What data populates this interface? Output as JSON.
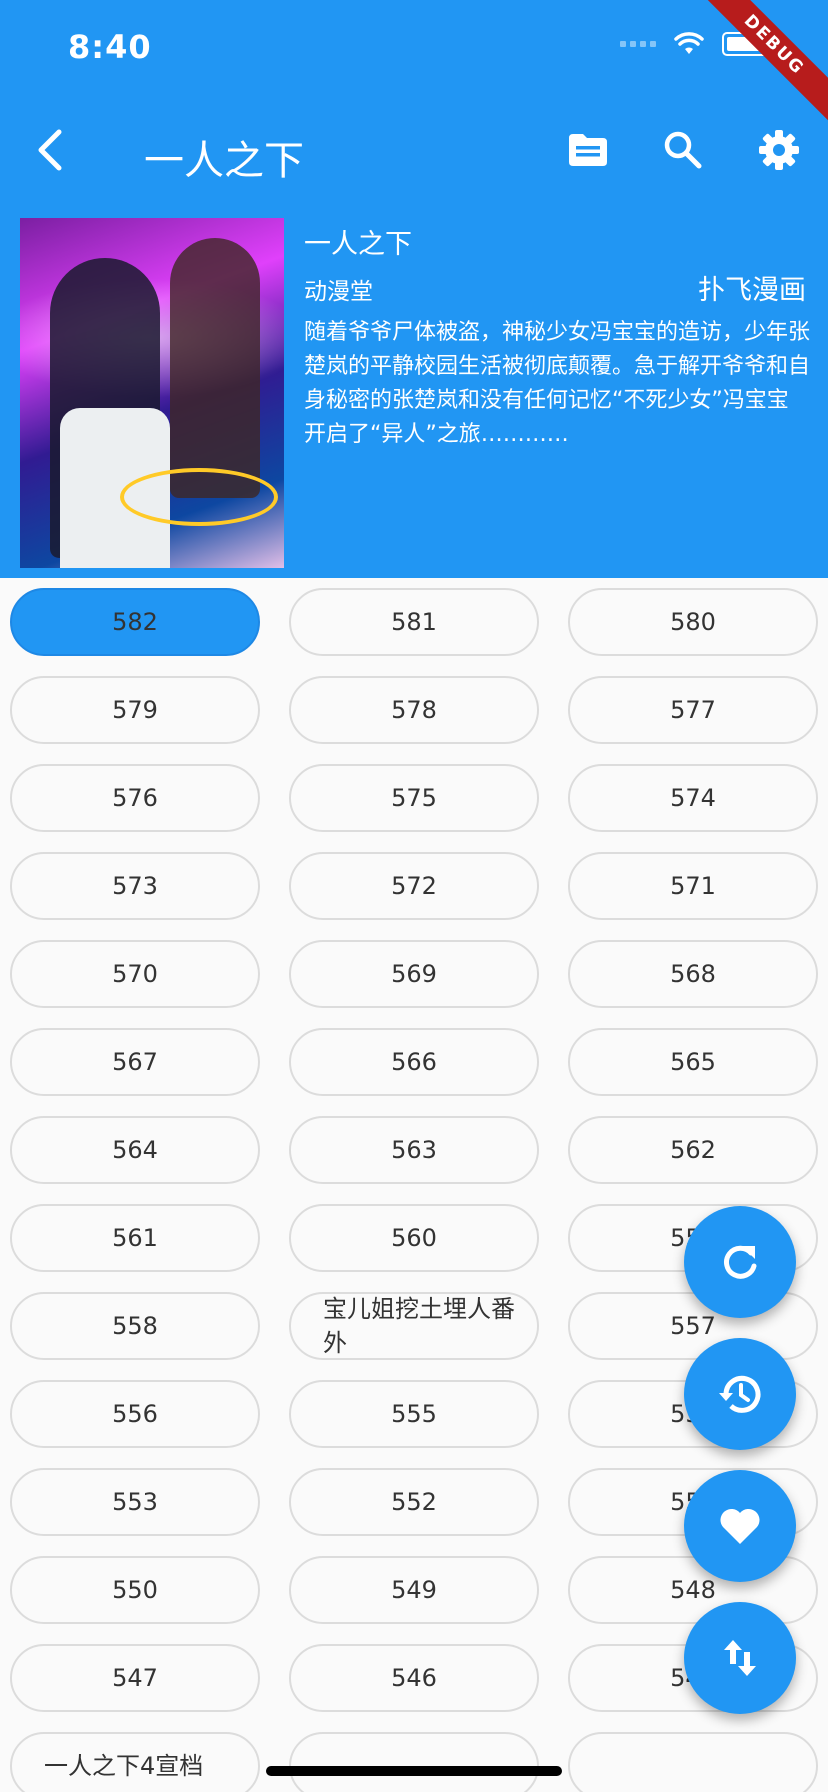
{
  "status_bar": {
    "time": "8:40",
    "debug_banner": "DEBUG"
  },
  "appbar": {
    "title": "一人之下",
    "icons": [
      "back-icon",
      "folder-icon",
      "search-icon",
      "settings-icon"
    ]
  },
  "comic": {
    "title": "一人之下",
    "source": "动漫堂",
    "site": "扑飞漫画",
    "description": "随着爷爷尸体被盗，神秘少女冯宝宝的造访，少年张楚岚的平静校园生活被彻底颠覆。急于解开爷爷和自身秘密的张楚岚和没有任何记忆“不死少女”冯宝宝开启了“异人”之旅…………"
  },
  "chapters": [
    "582",
    "581",
    "580",
    "579",
    "578",
    "577",
    "576",
    "575",
    "574",
    "573",
    "572",
    "571",
    "570",
    "569",
    "568",
    "567",
    "566",
    "565",
    "564",
    "563",
    "562",
    "561",
    "560",
    "559",
    "558",
    "宝儿姐挖土埋人番外",
    "557",
    "556",
    "555",
    "554",
    "553",
    "552",
    "551",
    "550",
    "549",
    "548",
    "547",
    "546",
    "545",
    "一人之下4宣档",
    "",
    ""
  ],
  "selected_chapter": "582",
  "fabs": [
    "refresh-icon",
    "history-icon",
    "favorite-icon",
    "sort-icon"
  ],
  "colors": {
    "primary": "#2196f3",
    "chip_border": "#dcdcdc",
    "background": "#fafafa",
    "debug": "#b71c1c"
  }
}
